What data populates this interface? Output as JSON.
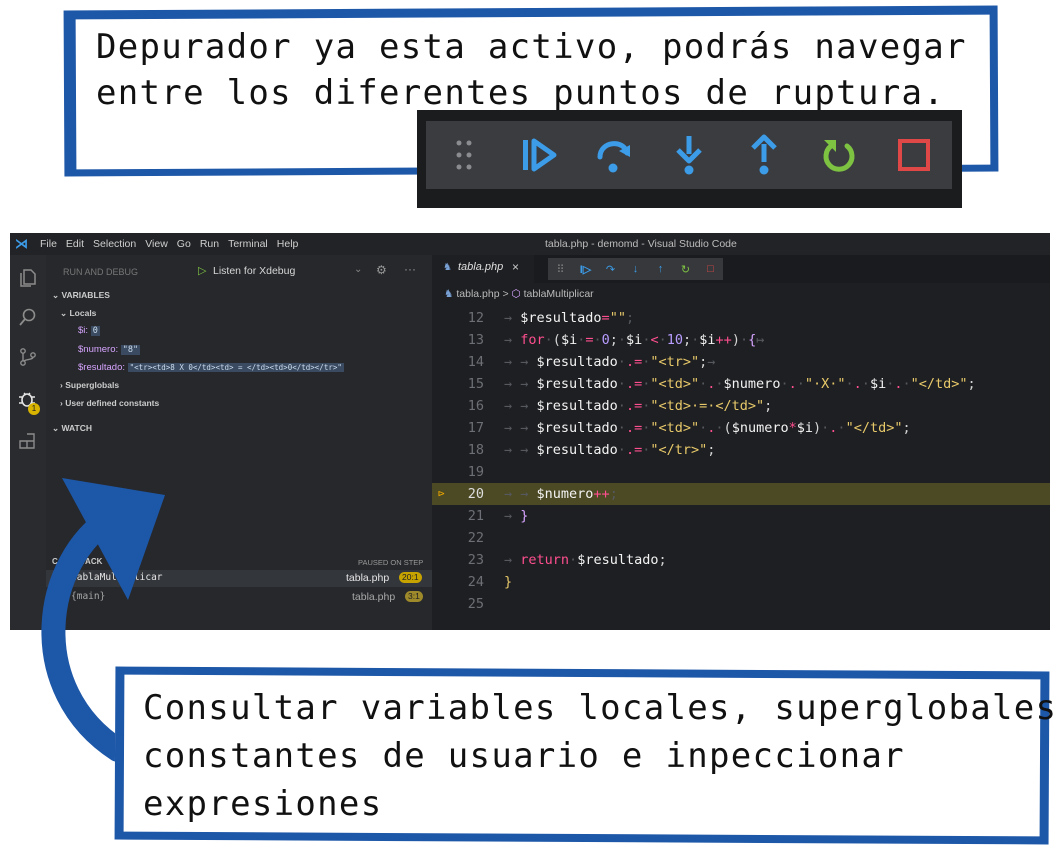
{
  "captions": {
    "top_line1": "Depurador ya esta activo, podrás navegar",
    "top_line2": "entre los diferentes puntos de ruptura.",
    "bottom_line1": "Consultar variables locales, superglobales,",
    "bottom_line2": "constantes de usuario e inpeccionar",
    "bottom_line3": "expresiones"
  },
  "colors": {
    "border_blue": "#1d57a8",
    "continue": "#3c9ce8",
    "restart": "#7ec242",
    "stop": "#e04848",
    "highlight_line": "#4c4a24"
  },
  "debug_toolbar": {
    "buttons": [
      {
        "name": "drag-handle-icon",
        "color": "#8a8c90"
      },
      {
        "name": "continue-icon",
        "color": "#3c9ce8"
      },
      {
        "name": "step-over-icon",
        "color": "#3c9ce8"
      },
      {
        "name": "step-into-icon",
        "color": "#3c9ce8"
      },
      {
        "name": "step-out-icon",
        "color": "#3c9ce8"
      },
      {
        "name": "restart-icon",
        "color": "#7ec242"
      },
      {
        "name": "stop-icon",
        "color": "#e04848"
      }
    ]
  },
  "vscode": {
    "menu": [
      "File",
      "Edit",
      "Selection",
      "View",
      "Go",
      "Run",
      "Terminal",
      "Help"
    ],
    "window_title": "tabla.php - demomd - Visual Studio Code",
    "sidebar": {
      "header": "RUN AND DEBUG",
      "config": "Listen for Xdebug",
      "variables_title": "VARIABLES",
      "locals_title": "Locals",
      "vars": [
        {
          "name": "$i:",
          "value": "0"
        },
        {
          "name": "$numero:",
          "value": "\"8\""
        },
        {
          "name": "$resultado:",
          "value": "\"<tr><td>8 X 0</td><td> = </td><td>0</td></tr>\""
        }
      ],
      "superglobals": "Superglobals",
      "user_constants": "User defined constants",
      "watch_title": "WATCH",
      "callstack_title": "CALL STACK",
      "paused": "PAUSED ON STEP",
      "frames": [
        {
          "name": "tablaMultiplicar",
          "file": "tabla.php",
          "pos": "20:1"
        },
        {
          "name": "{main}",
          "file": "tabla.php",
          "pos": "3:1"
        }
      ],
      "debug_badge": "1"
    },
    "editor": {
      "tab": "tabla.php",
      "tab_close": "×",
      "breadcrumb_file": "tabla.php",
      "breadcrumb_sep": ">",
      "breadcrumb_symbol": "tablaMultiplicar",
      "lines": [
        {
          "num": "12"
        },
        {
          "num": "13"
        },
        {
          "num": "14"
        },
        {
          "num": "15"
        },
        {
          "num": "16"
        },
        {
          "num": "17"
        },
        {
          "num": "18"
        },
        {
          "num": "19"
        },
        {
          "num": "20"
        },
        {
          "num": "21"
        },
        {
          "num": "22"
        },
        {
          "num": "23"
        },
        {
          "num": "24"
        },
        {
          "num": "25"
        }
      ]
    }
  }
}
